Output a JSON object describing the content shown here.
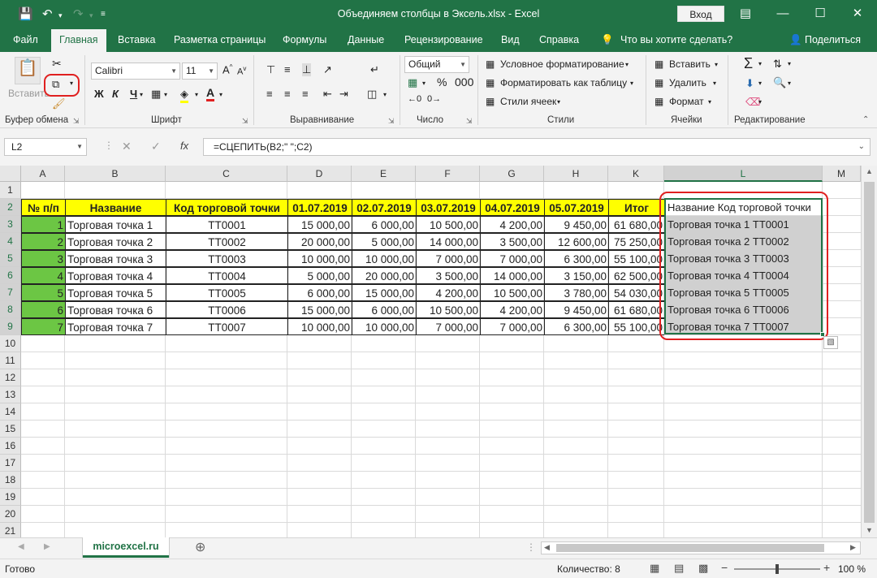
{
  "window": {
    "title": "Объединяем столбцы в Эксель.xlsx  -  Excel",
    "login_label": "Вход"
  },
  "tabs": [
    "Файл",
    "Главная",
    "Вставка",
    "Разметка страницы",
    "Формулы",
    "Данные",
    "Рецензирование",
    "Вид",
    "Справка"
  ],
  "tell_me": "Что вы хотите сделать?",
  "share_label": "Поделиться",
  "ribbon": {
    "clipboard": {
      "paste_label": "Вставить",
      "group": "Буфер обмена"
    },
    "font": {
      "name": "Calibri",
      "size": "11",
      "bold": "Ж",
      "italic": "К",
      "underline": "Ч",
      "group": "Шрифт"
    },
    "alignment": {
      "group": "Выравнивание"
    },
    "number": {
      "format": "Общий",
      "group": "Число"
    },
    "styles": {
      "conditional": "Условное форматирование",
      "as_table": "Форматировать как таблицу",
      "cell_styles": "Стили ячеек",
      "group": "Стили"
    },
    "cells": {
      "insert": "Вставить",
      "delete": "Удалить",
      "format": "Формат",
      "group": "Ячейки"
    },
    "editing": {
      "group": "Редактирование"
    }
  },
  "formula_bar": {
    "name_box": "L2",
    "formula": "=СЦЕПИТЬ(B2;\" \";C2)"
  },
  "columns": [
    "A",
    "B",
    "C",
    "D",
    "E",
    "F",
    "G",
    "H",
    "K",
    "L",
    "M"
  ],
  "rows": [
    "1",
    "2",
    "3",
    "4",
    "5",
    "6",
    "7",
    "8",
    "9",
    "10",
    "11",
    "12",
    "13",
    "14",
    "15",
    "16",
    "17",
    "18",
    "19",
    "20",
    "21"
  ],
  "table": {
    "headers": [
      "№ п/п",
      "Название",
      "Код торговой точки",
      "01.07.2019",
      "02.07.2019",
      "03.07.2019",
      "04.07.2019",
      "05.07.2019",
      "Итог",
      "Название Код торговой точки"
    ],
    "rows": [
      [
        "1",
        "Торговая точка 1",
        "ТТ0001",
        "15 000,00",
        "6 000,00",
        "10 500,00",
        "4 200,00",
        "9 450,00",
        "61 680,00",
        "Торговая точка 1 ТТ0001"
      ],
      [
        "2",
        "Торговая точка 2",
        "ТТ0002",
        "20 000,00",
        "5 000,00",
        "14 000,00",
        "3 500,00",
        "12 600,00",
        "75 250,00",
        "Торговая точка 2 ТТ0002"
      ],
      [
        "3",
        "Торговая точка 3",
        "ТТ0003",
        "10 000,00",
        "10 000,00",
        "7 000,00",
        "7 000,00",
        "6 300,00",
        "55 100,00",
        "Торговая точка 3 ТТ0003"
      ],
      [
        "4",
        "Торговая точка 4",
        "ТТ0004",
        "5 000,00",
        "20 000,00",
        "3 500,00",
        "14 000,00",
        "3 150,00",
        "62 500,00",
        "Торговая точка 4 ТТ0004"
      ],
      [
        "5",
        "Торговая точка 5",
        "ТТ0005",
        "6 000,00",
        "15 000,00",
        "4 200,00",
        "10 500,00",
        "3 780,00",
        "54 030,00",
        "Торговая точка 5 ТТ0005"
      ],
      [
        "6",
        "Торговая точка 6",
        "ТТ0006",
        "15 000,00",
        "6 000,00",
        "10 500,00",
        "4 200,00",
        "9 450,00",
        "61 680,00",
        "Торговая точка 6 ТТ0006"
      ],
      [
        "7",
        "Торговая точка 7",
        "ТТ0007",
        "10 000,00",
        "10 000,00",
        "7 000,00",
        "7 000,00",
        "6 300,00",
        "55 100,00",
        "Торговая точка 7 ТТ0007"
      ]
    ]
  },
  "sheet_tab": "microexcel.ru",
  "status": {
    "ready": "Готово",
    "count": "Количество: 8",
    "zoom": "100 %"
  },
  "colors": {
    "accent": "#217346",
    "header_fill": "#ffff00",
    "index_fill": "#6cc644",
    "highlight": "#e02020"
  }
}
